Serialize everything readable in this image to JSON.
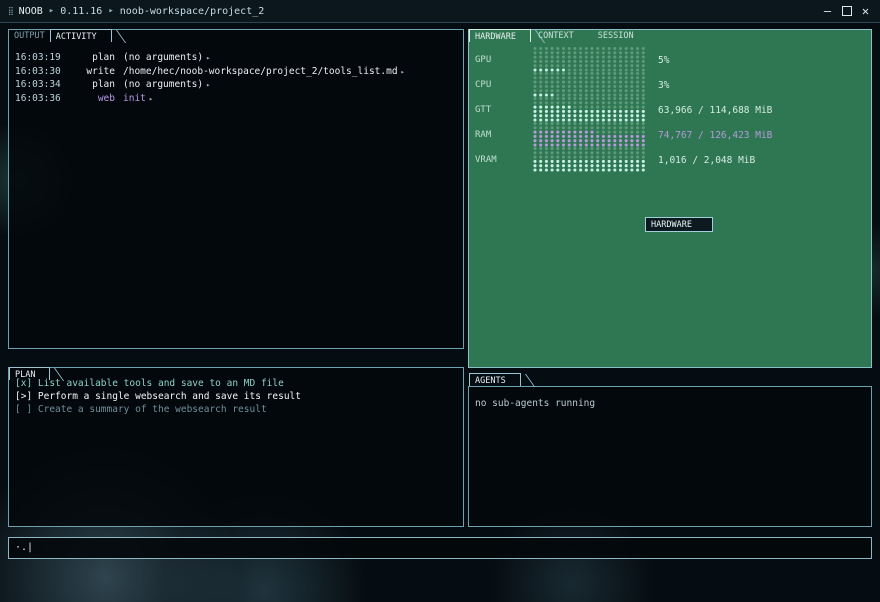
{
  "titlebar": {
    "grip": "⁞⁞",
    "app_name": "NOOB",
    "sep1": "▸",
    "version": "0.11.16",
    "sep2": "▸",
    "workspace_path": "noob-workspace/project_2",
    "controls": {
      "minimize": "—",
      "maximize": "□",
      "close": "✕"
    }
  },
  "activity_panel": {
    "tabs": [
      {
        "label": "OUTPUT",
        "active": false
      },
      {
        "label": "ACTIVITY",
        "active": true
      }
    ],
    "rows": [
      {
        "time": "16:03:19",
        "verb": "plan",
        "args": "(no arguments)",
        "marker": "▸",
        "kind": "normal"
      },
      {
        "time": "16:03:30",
        "verb": "write",
        "args": "/home/hec/noob-workspace/project_2/tools_list.md",
        "marker": "▸",
        "kind": "normal"
      },
      {
        "time": "16:03:34",
        "verb": "plan",
        "args": "(no arguments)",
        "marker": "▸",
        "kind": "normal"
      },
      {
        "time": "16:03:36",
        "verb": "web",
        "args": "init",
        "marker": "▸",
        "kind": "web"
      }
    ]
  },
  "hardware_panel": {
    "tabs": [
      {
        "label": "HARDWARE",
        "active": true
      },
      {
        "label": "CONTEXT",
        "active": false
      },
      {
        "label": "SESSION",
        "active": false
      }
    ],
    "colors": {
      "bg": "#2f7653",
      "dot_on": "#c5f0e3",
      "dot_off": "#5c9a7b",
      "ram_on": "#b59bd9"
    },
    "metrics": [
      {
        "label": "GPU",
        "value": "5%",
        "fraction": 0.05
      },
      {
        "label": "CPU",
        "value": "3%",
        "fraction": 0.03
      },
      {
        "label": "GTT",
        "value": "63,966 / 114,688 MiB",
        "fraction": 0.558
      },
      {
        "label": "RAM",
        "value": "74,767 / 126,423 MiB",
        "fraction": 0.591
      },
      {
        "label": "VRAM",
        "value": "1,016 / 2,048 MiB",
        "fraction": 0.496
      }
    ],
    "badge": "HARDWARE"
  },
  "plan_panel": {
    "tab_label": "PLAN",
    "items": [
      {
        "text": "[x] List available tools and save to an MD file",
        "state": "done"
      },
      {
        "text": "[>] Perform a single websearch and save its result",
        "state": "current"
      },
      {
        "text": "[ ] Create a summary of the websearch result",
        "state": "todo"
      }
    ]
  },
  "agents_panel": {
    "tab_label": "AGENTS",
    "message": "no sub-agents running"
  },
  "input": {
    "prompt": "·.|",
    "value": ""
  }
}
